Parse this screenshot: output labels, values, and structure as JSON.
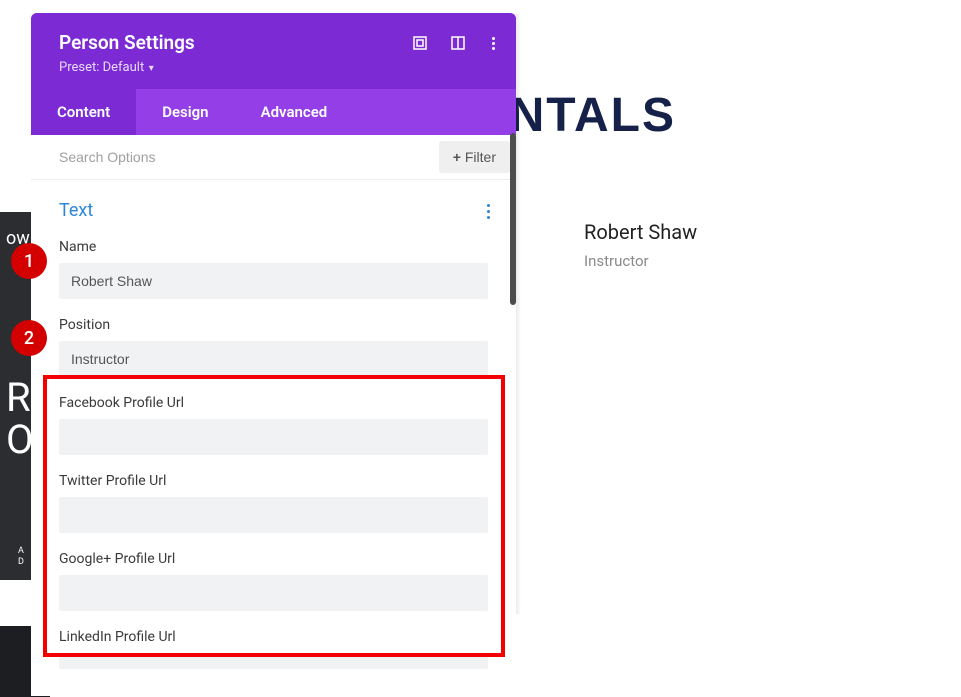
{
  "background": {
    "title_fragment": "MENTALS"
  },
  "left_strip": {
    "row1": "ow",
    "big": "R",
    "big2": "O",
    "credit1": "A",
    "credit2": "D"
  },
  "panel": {
    "title": "Person Settings",
    "preset_label": "Preset: Default",
    "tabs": {
      "content": "Content",
      "design": "Design",
      "advanced": "Advanced"
    },
    "search_placeholder": "Search Options",
    "filter_label": "Filter",
    "section_title": "Text",
    "fields": {
      "name": {
        "label": "Name",
        "value": "Robert Shaw"
      },
      "position": {
        "label": "Position",
        "value": "Instructor"
      },
      "facebook": {
        "label": "Facebook Profile Url",
        "value": ""
      },
      "twitter": {
        "label": "Twitter Profile Url",
        "value": ""
      },
      "google": {
        "label": "Google+ Profile Url",
        "value": ""
      },
      "linkedin": {
        "label": "LinkedIn Profile Url",
        "value": ""
      }
    }
  },
  "preview": {
    "name": "Robert Shaw",
    "position": "Instructor"
  },
  "badges": {
    "b1": "1",
    "b2": "2"
  }
}
